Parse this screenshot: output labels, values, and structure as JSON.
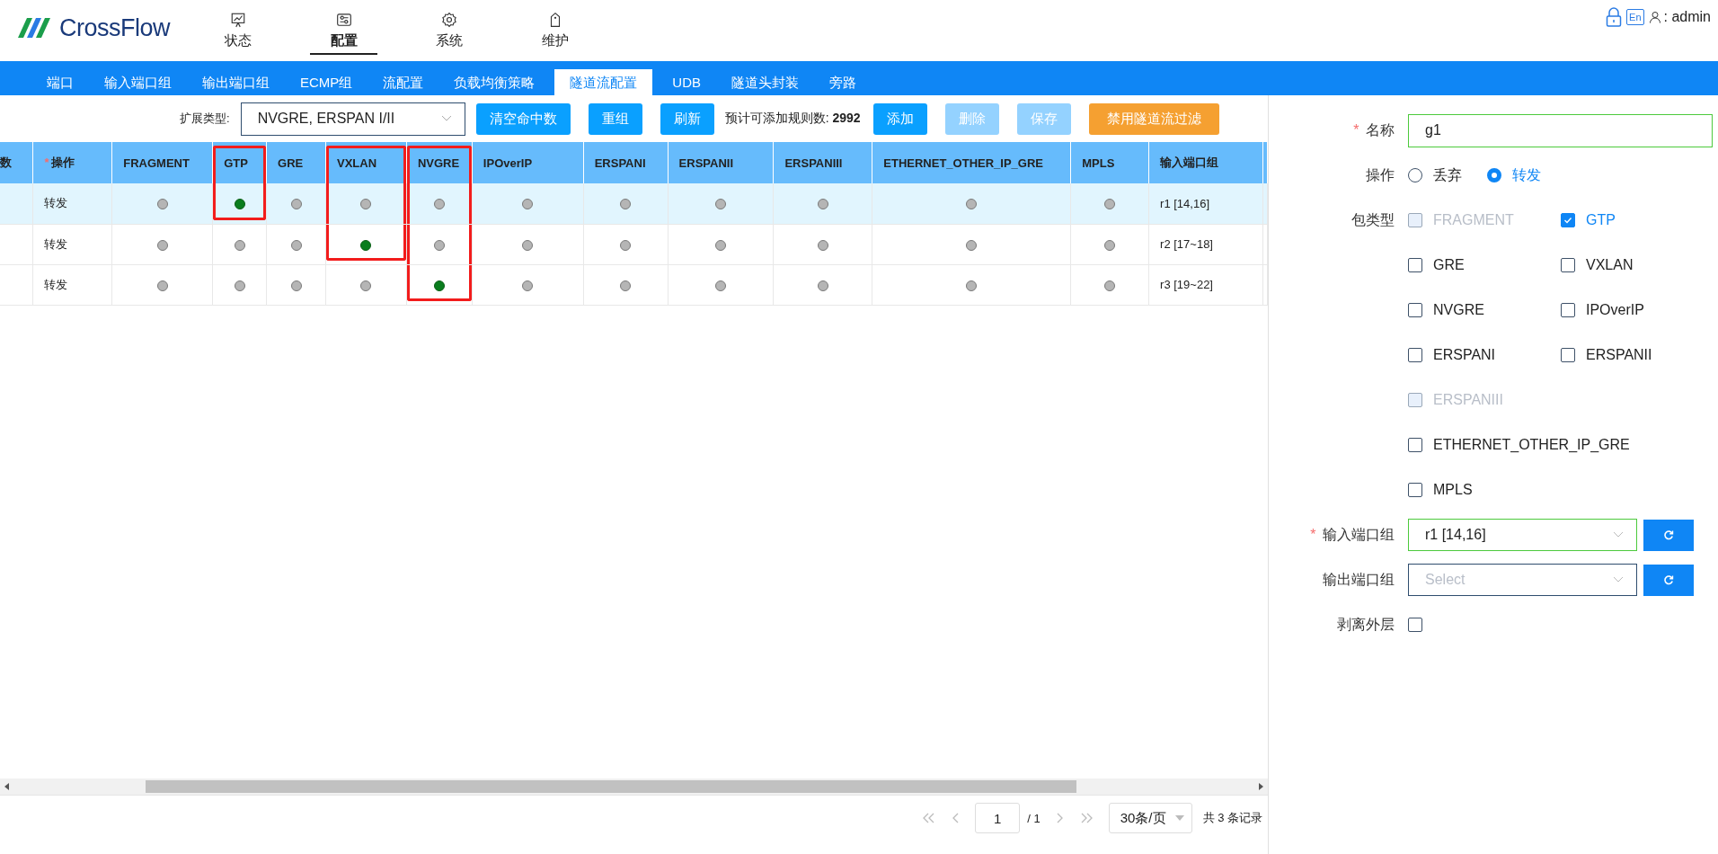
{
  "header": {
    "logo": "CrossFlow",
    "nav": [
      {
        "label": "状态",
        "selected": false
      },
      {
        "label": "配置",
        "selected": true
      },
      {
        "label": "系统",
        "selected": false
      },
      {
        "label": "维护",
        "selected": false
      }
    ],
    "lang": "En",
    "user": ": admin"
  },
  "tabs": [
    {
      "label": "端口",
      "selected": false
    },
    {
      "label": "输入端口组",
      "selected": false
    },
    {
      "label": "输出端口组",
      "selected": false
    },
    {
      "label": "ECMP组",
      "selected": false
    },
    {
      "label": "流配置",
      "selected": false
    },
    {
      "label": "负载均衡策略",
      "selected": false
    },
    {
      "label": "隧道流配置",
      "selected": true
    },
    {
      "label": "UDB",
      "selected": false
    },
    {
      "label": "隧道头封装",
      "selected": false
    },
    {
      "label": "旁路",
      "selected": false
    }
  ],
  "toolbar": {
    "ext_label": "扩展类型:",
    "ext_value": "NVGRE, ERSPAN I/II",
    "buttons_a": [
      {
        "label": "清空命中数",
        "kind": "primary",
        "disabled": false
      },
      {
        "label": "重组",
        "kind": "primary",
        "disabled": false
      },
      {
        "label": "刷新",
        "kind": "primary",
        "disabled": false
      }
    ],
    "estimate": "预计可添加规则数: **2992**",
    "buttons_b": [
      {
        "label": "添加",
        "kind": "primary",
        "disabled": false
      },
      {
        "label": "删除",
        "kind": "primary",
        "disabled": true
      },
      {
        "label": "保存",
        "kind": "primary",
        "disabled": true
      },
      {
        "label": "禁用隧道流过滤",
        "kind": "warning",
        "disabled": false
      }
    ]
  },
  "table": {
    "lead_column": "数",
    "action_mark": "*",
    "action_column": "操作",
    "flag_columns": [
      {
        "label": "FRAGMENT",
        "marked": false
      },
      {
        "label": "GTP",
        "marked": true
      },
      {
        "label": "GRE",
        "marked": false
      },
      {
        "label": "VXLAN",
        "marked": true
      },
      {
        "label": "NVGRE",
        "marked": true
      },
      {
        "label": "IPOverIP",
        "marked": false
      },
      {
        "label": "ERSPANI",
        "marked": false
      },
      {
        "label": "ERSPANII",
        "marked": false
      },
      {
        "label": "ERSPANIII",
        "marked": false
      },
      {
        "label": "ETHERNET_OTHER_IP_GRE",
        "marked": false
      },
      {
        "label": "MPLS",
        "marked": false
      }
    ],
    "port_column": "输入端口组",
    "rows": [
      {
        "selected": true,
        "action": "转发",
        "port_group": "r1 [14,16]",
        "flags": [
          {
            "on": false,
            "marked": false
          },
          {
            "on": true,
            "marked": true
          },
          {
            "on": false,
            "marked": false
          },
          {
            "on": false,
            "marked": true
          },
          {
            "on": false,
            "marked": true
          },
          {
            "on": false,
            "marked": false
          },
          {
            "on": false,
            "marked": false
          },
          {
            "on": false,
            "marked": false
          },
          {
            "on": false,
            "marked": false
          },
          {
            "on": false,
            "marked": false
          },
          {
            "on": false,
            "marked": false
          }
        ]
      },
      {
        "selected": false,
        "action": "转发",
        "port_group": "r2 [17~18]",
        "flags": [
          {
            "on": false,
            "marked": false
          },
          {
            "on": false,
            "marked": false
          },
          {
            "on": false,
            "marked": false
          },
          {
            "on": true,
            "marked": true
          },
          {
            "on": false,
            "marked": true
          },
          {
            "on": false,
            "marked": false
          },
          {
            "on": false,
            "marked": false
          },
          {
            "on": false,
            "marked": false
          },
          {
            "on": false,
            "marked": false
          },
          {
            "on": false,
            "marked": false
          },
          {
            "on": false,
            "marked": false
          }
        ]
      },
      {
        "selected": false,
        "action": "转发",
        "port_group": "r3 [19~22]",
        "flags": [
          {
            "on": false,
            "marked": false
          },
          {
            "on": false,
            "marked": false
          },
          {
            "on": false,
            "marked": false
          },
          {
            "on": false,
            "marked": false
          },
          {
            "on": true,
            "marked": true
          },
          {
            "on": false,
            "marked": false
          },
          {
            "on": false,
            "marked": false
          },
          {
            "on": false,
            "marked": false
          },
          {
            "on": false,
            "marked": false
          },
          {
            "on": false,
            "marked": false
          },
          {
            "on": false,
            "marked": false
          }
        ]
      }
    ]
  },
  "pagination": {
    "page": "1",
    "total_pages": "/ 1",
    "page_size": "30条/页",
    "summary": "共 3 条记录"
  },
  "form": {
    "name_mark": "*",
    "name_label": "名称",
    "name_value": "g1",
    "action_label": "操作",
    "actions": [
      {
        "label": "丢弃",
        "selected": false
      },
      {
        "label": "转发",
        "selected": true
      }
    ],
    "packet_label": "包类型",
    "packet_rows": [
      [
        {
          "label": "FRAGMENT",
          "checked": false,
          "disabled": true
        },
        {
          "label": "GTP",
          "checked": true,
          "disabled": false
        }
      ],
      [
        {
          "label": "GRE",
          "checked": false,
          "disabled": false
        },
        {
          "label": "VXLAN",
          "checked": false,
          "disabled": false
        }
      ],
      [
        {
          "label": "NVGRE",
          "checked": false,
          "disabled": false
        },
        {
          "label": "IPOverIP",
          "checked": false,
          "disabled": false
        }
      ],
      [
        {
          "label": "ERSPANI",
          "checked": false,
          "disabled": false
        },
        {
          "label": "ERSPANII",
          "checked": false,
          "disabled": false
        }
      ],
      [
        {
          "label": "ERSPANIII",
          "checked": false,
          "disabled": true
        }
      ],
      [
        {
          "label": "ETHERNET_OTHER_IP_GRE",
          "checked": false,
          "disabled": false
        }
      ],
      [
        {
          "label": "MPLS",
          "checked": false,
          "disabled": false
        }
      ]
    ],
    "in_mark": "*",
    "in_label": "输入端口组",
    "in_value": "r1 [14,16]",
    "out_label": "输出端口组",
    "out_placeholder": "Select",
    "strip_label": "剥离外层",
    "strip_checked": false
  }
}
